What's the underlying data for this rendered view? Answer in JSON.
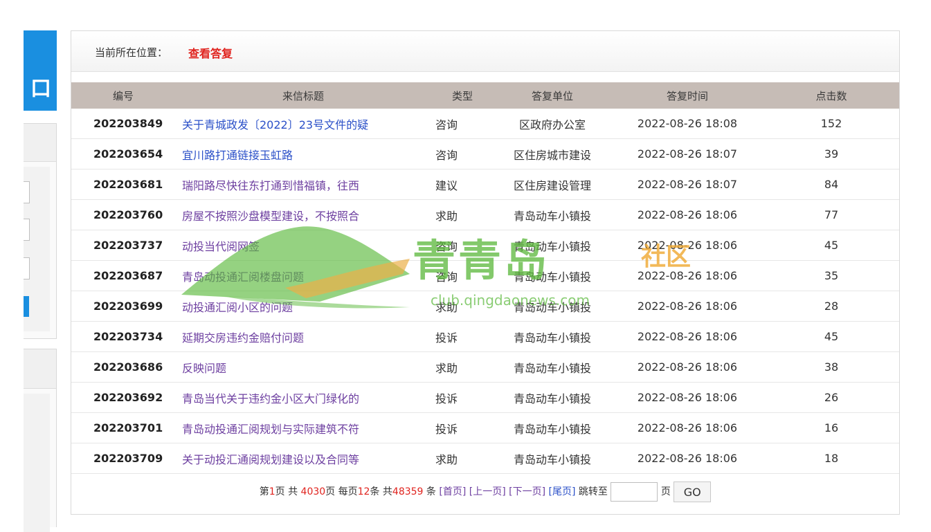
{
  "sidebar": {
    "banner_char": "口"
  },
  "breadcrumb": {
    "label": "当前所在位置：",
    "current": "查看答复"
  },
  "table": {
    "headers": [
      "编号",
      "来信标题",
      "类型",
      "答复单位",
      "答复时间",
      "点击数"
    ],
    "rows": [
      {
        "id": "202203849",
        "title": "关于青城政发〔2022〕23号文件的疑",
        "type": "咨询",
        "unit": "区政府办公室",
        "time": "2022-08-26  18:08",
        "clicks": "152"
      },
      {
        "id": "202203654",
        "title": "宜川路打通链接玉虹路",
        "type": "咨询",
        "unit": "区住房城市建设",
        "time": "2022-08-26  18:07",
        "clicks": "39"
      },
      {
        "id": "202203681",
        "title": "瑞阳路尽快往东打通到惜福镇，往西",
        "type": "建议",
        "unit": "区住房建设管理",
        "time": "2022-08-26  18:07",
        "clicks": "84"
      },
      {
        "id": "202203760",
        "title": "房屋不按照沙盘模型建设，不按照合",
        "type": "求助",
        "unit": "青岛动车小镇投",
        "time": "2022-08-26  18:06",
        "clicks": "77"
      },
      {
        "id": "202203737",
        "title": "动投当代阅网签",
        "type": "咨询",
        "unit": "青岛动车小镇投",
        "time": "2022-08-26  18:06",
        "clicks": "45"
      },
      {
        "id": "202203687",
        "title": "青岛动投通汇阅楼盘问题",
        "type": "咨询",
        "unit": "青岛动车小镇投",
        "time": "2022-08-26  18:06",
        "clicks": "35"
      },
      {
        "id": "202203699",
        "title": "动投通汇阅小区的问题",
        "type": "求助",
        "unit": "青岛动车小镇投",
        "time": "2022-08-26  18:06",
        "clicks": "28"
      },
      {
        "id": "202203734",
        "title": "延期交房违约金赔付问题",
        "type": "投诉",
        "unit": "青岛动车小镇投",
        "time": "2022-08-26  18:06",
        "clicks": "45"
      },
      {
        "id": "202203686",
        "title": "反映问题",
        "type": "求助",
        "unit": "青岛动车小镇投",
        "time": "2022-08-26  18:06",
        "clicks": "38"
      },
      {
        "id": "202203692",
        "title": "青岛当代关于违约金小区大门绿化的",
        "type": "投诉",
        "unit": "青岛动车小镇投",
        "time": "2022-08-26  18:06",
        "clicks": "26"
      },
      {
        "id": "202203701",
        "title": "青岛动投通汇阅规划与实际建筑不符",
        "type": "投诉",
        "unit": "青岛动车小镇投",
        "time": "2022-08-26  18:06",
        "clicks": "16"
      },
      {
        "id": "202203709",
        "title": "关于动投汇通阅规划建设以及合同等",
        "type": "求助",
        "unit": "青岛动车小镇投",
        "time": "2022-08-26  18:06",
        "clicks": "18"
      }
    ]
  },
  "pager": {
    "text_page_prefix": "第",
    "current_page": "1",
    "text_page_suffix": "页 共 ",
    "total_pages": "4030",
    "text_per_prefix": "页 每页",
    "per_page": "12",
    "text_total_prefix": "条 共",
    "total_items": "48359",
    "text_total_suffix": " 条",
    "first": "[首页]",
    "prev": "[上一页]",
    "next": "[下一页]",
    "last": "[尾页]",
    "jump_label": "跳转至",
    "page_unit": "页",
    "go": "GO",
    "jump_value": ""
  },
  "watermark": {
    "brand": "青青岛",
    "sub": "社区",
    "url": "club.qingdaonews.com"
  },
  "colors": {
    "accent_blue": "#1a8fe0",
    "highlight_red": "#e0231e",
    "link_purple": "#6d3fa0",
    "link_blue": "#2b50c8",
    "header_bg": "#c6bcb6"
  }
}
